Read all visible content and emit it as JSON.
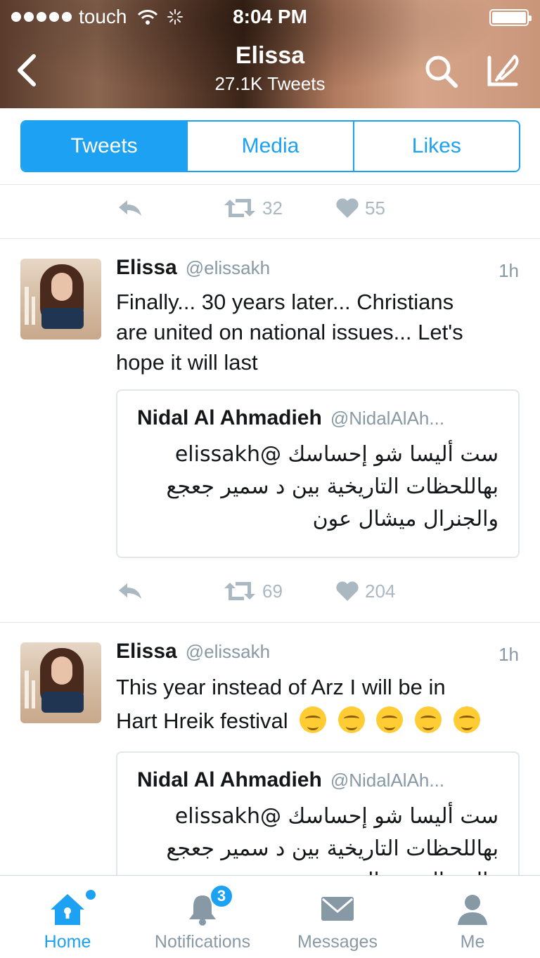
{
  "status_bar": {
    "carrier": "touch",
    "time": "8:04 PM"
  },
  "nav": {
    "title": "Elissa",
    "subtitle": "27.1K Tweets",
    "back_icon": "chevron-left-icon",
    "search_icon": "search-icon",
    "compose_icon": "compose-icon"
  },
  "tabs": [
    {
      "label": "Tweets",
      "active": true
    },
    {
      "label": "Media",
      "active": false
    },
    {
      "label": "Likes",
      "active": false
    }
  ],
  "prev_tweet_actions": {
    "retweets": "32",
    "likes": "55"
  },
  "tweets": [
    {
      "name": "Elissa",
      "handle": "@elissakh",
      "time": "1h",
      "text_lines": [
        "Finally... 30 years later... Christians",
        "are united on national issues... Let's",
        "hope it will last"
      ],
      "quote": {
        "name": "Nidal Al Ahmadieh",
        "handle": "@NidalAlAh...",
        "lines": [
          "ست أليسا شو إحساسك @elissakh",
          "بهاللحظات التاريخية بين د سمير جعجع",
          "والجنرال ميشال عون"
        ]
      },
      "retweets": "69",
      "likes": "204"
    },
    {
      "name": "Elissa",
      "handle": "@elissakh",
      "time": "1h",
      "text_lines": [
        "This year instead of Arz I will be in",
        "Hart Hreik festival"
      ],
      "emoji": "relieved-face-emoji",
      "emoji_count": 5,
      "quote": {
        "name": "Nidal Al Ahmadieh",
        "handle": "@NidalAlAh...",
        "lines": [
          "ست أليسا شو إحساسك @elissakh",
          "بهاللحظات التاريخية بين د سمير جعجع",
          "والجنرال ميشال عون"
        ]
      }
    }
  ],
  "tabbar": {
    "items": [
      {
        "label": "Home",
        "icon": "home-icon",
        "active": true
      },
      {
        "label": "Notifications",
        "icon": "bell-icon",
        "badge": "3"
      },
      {
        "label": "Messages",
        "icon": "envelope-icon"
      },
      {
        "label": "Me",
        "icon": "person-icon"
      }
    ]
  },
  "colors": {
    "accent": "#1da1f2",
    "muted": "#8899a6",
    "icon_gray": "#aab8c2",
    "divider": "#e1e8ed"
  }
}
